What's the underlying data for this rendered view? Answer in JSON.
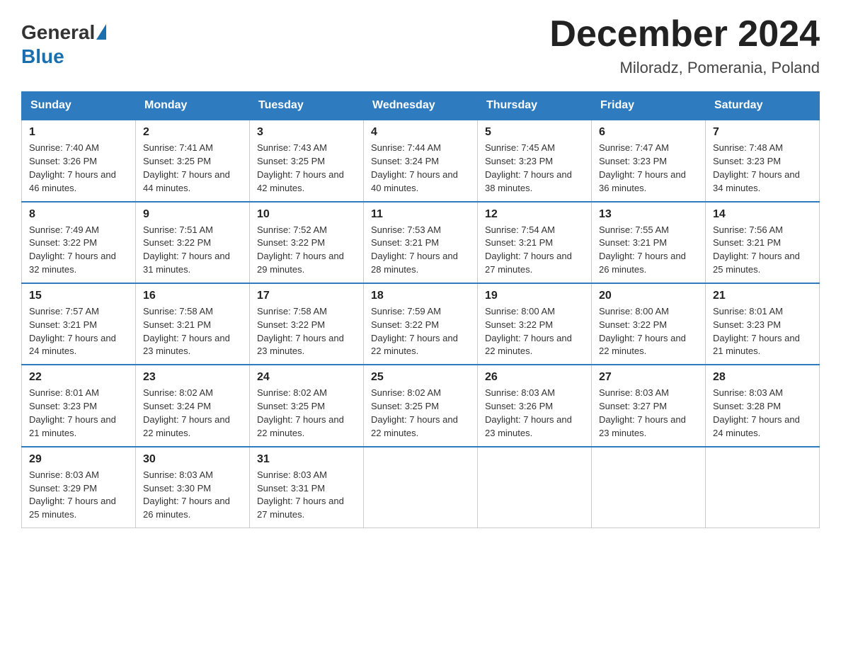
{
  "header": {
    "logo_general": "General",
    "logo_blue": "Blue",
    "month_title": "December 2024",
    "location": "Miloradz, Pomerania, Poland"
  },
  "days_of_week": [
    "Sunday",
    "Monday",
    "Tuesday",
    "Wednesday",
    "Thursday",
    "Friday",
    "Saturday"
  ],
  "weeks": [
    [
      {
        "day": "1",
        "sunrise": "7:40 AM",
        "sunset": "3:26 PM",
        "daylight": "7 hours and 46 minutes."
      },
      {
        "day": "2",
        "sunrise": "7:41 AM",
        "sunset": "3:25 PM",
        "daylight": "7 hours and 44 minutes."
      },
      {
        "day": "3",
        "sunrise": "7:43 AM",
        "sunset": "3:25 PM",
        "daylight": "7 hours and 42 minutes."
      },
      {
        "day": "4",
        "sunrise": "7:44 AM",
        "sunset": "3:24 PM",
        "daylight": "7 hours and 40 minutes."
      },
      {
        "day": "5",
        "sunrise": "7:45 AM",
        "sunset": "3:23 PM",
        "daylight": "7 hours and 38 minutes."
      },
      {
        "day": "6",
        "sunrise": "7:47 AM",
        "sunset": "3:23 PM",
        "daylight": "7 hours and 36 minutes."
      },
      {
        "day": "7",
        "sunrise": "7:48 AM",
        "sunset": "3:23 PM",
        "daylight": "7 hours and 34 minutes."
      }
    ],
    [
      {
        "day": "8",
        "sunrise": "7:49 AM",
        "sunset": "3:22 PM",
        "daylight": "7 hours and 32 minutes."
      },
      {
        "day": "9",
        "sunrise": "7:51 AM",
        "sunset": "3:22 PM",
        "daylight": "7 hours and 31 minutes."
      },
      {
        "day": "10",
        "sunrise": "7:52 AM",
        "sunset": "3:22 PM",
        "daylight": "7 hours and 29 minutes."
      },
      {
        "day": "11",
        "sunrise": "7:53 AM",
        "sunset": "3:21 PM",
        "daylight": "7 hours and 28 minutes."
      },
      {
        "day": "12",
        "sunrise": "7:54 AM",
        "sunset": "3:21 PM",
        "daylight": "7 hours and 27 minutes."
      },
      {
        "day": "13",
        "sunrise": "7:55 AM",
        "sunset": "3:21 PM",
        "daylight": "7 hours and 26 minutes."
      },
      {
        "day": "14",
        "sunrise": "7:56 AM",
        "sunset": "3:21 PM",
        "daylight": "7 hours and 25 minutes."
      }
    ],
    [
      {
        "day": "15",
        "sunrise": "7:57 AM",
        "sunset": "3:21 PM",
        "daylight": "7 hours and 24 minutes."
      },
      {
        "day": "16",
        "sunrise": "7:58 AM",
        "sunset": "3:21 PM",
        "daylight": "7 hours and 23 minutes."
      },
      {
        "day": "17",
        "sunrise": "7:58 AM",
        "sunset": "3:22 PM",
        "daylight": "7 hours and 23 minutes."
      },
      {
        "day": "18",
        "sunrise": "7:59 AM",
        "sunset": "3:22 PM",
        "daylight": "7 hours and 22 minutes."
      },
      {
        "day": "19",
        "sunrise": "8:00 AM",
        "sunset": "3:22 PM",
        "daylight": "7 hours and 22 minutes."
      },
      {
        "day": "20",
        "sunrise": "8:00 AM",
        "sunset": "3:22 PM",
        "daylight": "7 hours and 22 minutes."
      },
      {
        "day": "21",
        "sunrise": "8:01 AM",
        "sunset": "3:23 PM",
        "daylight": "7 hours and 21 minutes."
      }
    ],
    [
      {
        "day": "22",
        "sunrise": "8:01 AM",
        "sunset": "3:23 PM",
        "daylight": "7 hours and 21 minutes."
      },
      {
        "day": "23",
        "sunrise": "8:02 AM",
        "sunset": "3:24 PM",
        "daylight": "7 hours and 22 minutes."
      },
      {
        "day": "24",
        "sunrise": "8:02 AM",
        "sunset": "3:25 PM",
        "daylight": "7 hours and 22 minutes."
      },
      {
        "day": "25",
        "sunrise": "8:02 AM",
        "sunset": "3:25 PM",
        "daylight": "7 hours and 22 minutes."
      },
      {
        "day": "26",
        "sunrise": "8:03 AM",
        "sunset": "3:26 PM",
        "daylight": "7 hours and 23 minutes."
      },
      {
        "day": "27",
        "sunrise": "8:03 AM",
        "sunset": "3:27 PM",
        "daylight": "7 hours and 23 minutes."
      },
      {
        "day": "28",
        "sunrise": "8:03 AM",
        "sunset": "3:28 PM",
        "daylight": "7 hours and 24 minutes."
      }
    ],
    [
      {
        "day": "29",
        "sunrise": "8:03 AM",
        "sunset": "3:29 PM",
        "daylight": "7 hours and 25 minutes."
      },
      {
        "day": "30",
        "sunrise": "8:03 AM",
        "sunset": "3:30 PM",
        "daylight": "7 hours and 26 minutes."
      },
      {
        "day": "31",
        "sunrise": "8:03 AM",
        "sunset": "3:31 PM",
        "daylight": "7 hours and 27 minutes."
      },
      null,
      null,
      null,
      null
    ]
  ]
}
